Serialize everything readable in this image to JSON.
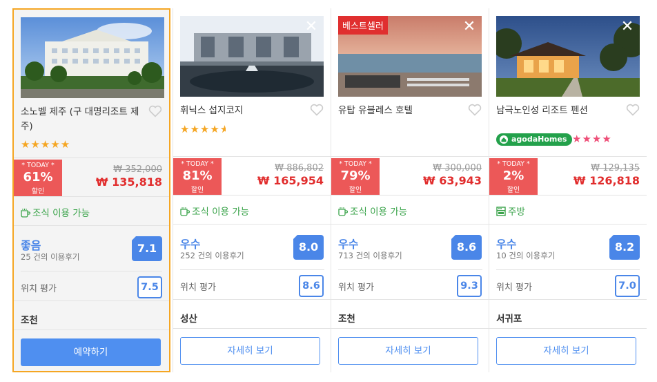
{
  "cards": [
    {
      "name": "소노벨 제주 (구 대명리조트 제주)",
      "stars_text": "★★★★★",
      "star_color": "#f5a623",
      "badge": "",
      "today_label": "* TODAY *",
      "discount": "61%",
      "discount_label": "할인",
      "original_price": "₩ 352,000",
      "final_price": "₩ 135,818",
      "amenity": "조식 이용 가능",
      "amenity_icon": "coffee-cup-icon",
      "review_word": "좋음",
      "review_count": "25 건의 이용후기",
      "review_score": "7.1",
      "location_label": "위치 평가",
      "location_score": "7.5",
      "city": "조천",
      "button_label": "예약하기",
      "selected": true
    },
    {
      "name": "휘닉스 섭지코지",
      "stars_text": "★★★★",
      "star_color": "#f5a623",
      "badge": "",
      "today_label": "* TODAY *",
      "discount": "81%",
      "discount_label": "할인",
      "original_price": "₩ 886,802",
      "final_price": "₩ 165,954",
      "amenity": "조식 이용 가능",
      "amenity_icon": "coffee-cup-icon",
      "review_word": "우수",
      "review_count": "252 건의 이용후기",
      "review_score": "8.0",
      "location_label": "위치 평가",
      "location_score": "8.6",
      "city": "성산",
      "button_label": "자세히 보기",
      "selected": false
    },
    {
      "name": "유탑 유블레스 호텔",
      "stars_text": "",
      "star_color": "#f5a623",
      "badge": "베스트셀러",
      "today_label": "* TODAY *",
      "discount": "79%",
      "discount_label": "할인",
      "original_price": "₩ 300,000",
      "final_price": "₩ 63,943",
      "amenity": "조식 이용 가능",
      "amenity_icon": "coffee-cup-icon",
      "review_word": "우수",
      "review_count": "713 건의 이용후기",
      "review_score": "8.6",
      "location_label": "위치 평가",
      "location_score": "9.3",
      "city": "조천",
      "button_label": "자세히 보기",
      "selected": false
    },
    {
      "name": "남극노인성 리조트 펜션",
      "stars_text": "★★★★",
      "star_color": "#ee4f78",
      "badge": "",
      "agoda_label": "agodaHomes",
      "today_label": "* TODAY *",
      "discount": "2%",
      "discount_label": "할인",
      "original_price": "₩ 129,135",
      "final_price": "₩ 126,818",
      "amenity": "주방",
      "amenity_icon": "kitchen-icon",
      "review_word": "우수",
      "review_count": "10 건의 이용후기",
      "review_score": "8.2",
      "location_label": "위치 평가",
      "location_score": "7.0",
      "city": "서귀포",
      "button_label": "자세히 보기",
      "selected": false
    }
  ],
  "colors": {
    "selected_border": "#f5a623",
    "discount_bg": "#ec5858",
    "price_red": "#e12d2d",
    "amenity_green": "#3aa34a",
    "review_blue": "#4a86e8",
    "button_blue": "#4f8ff0"
  }
}
